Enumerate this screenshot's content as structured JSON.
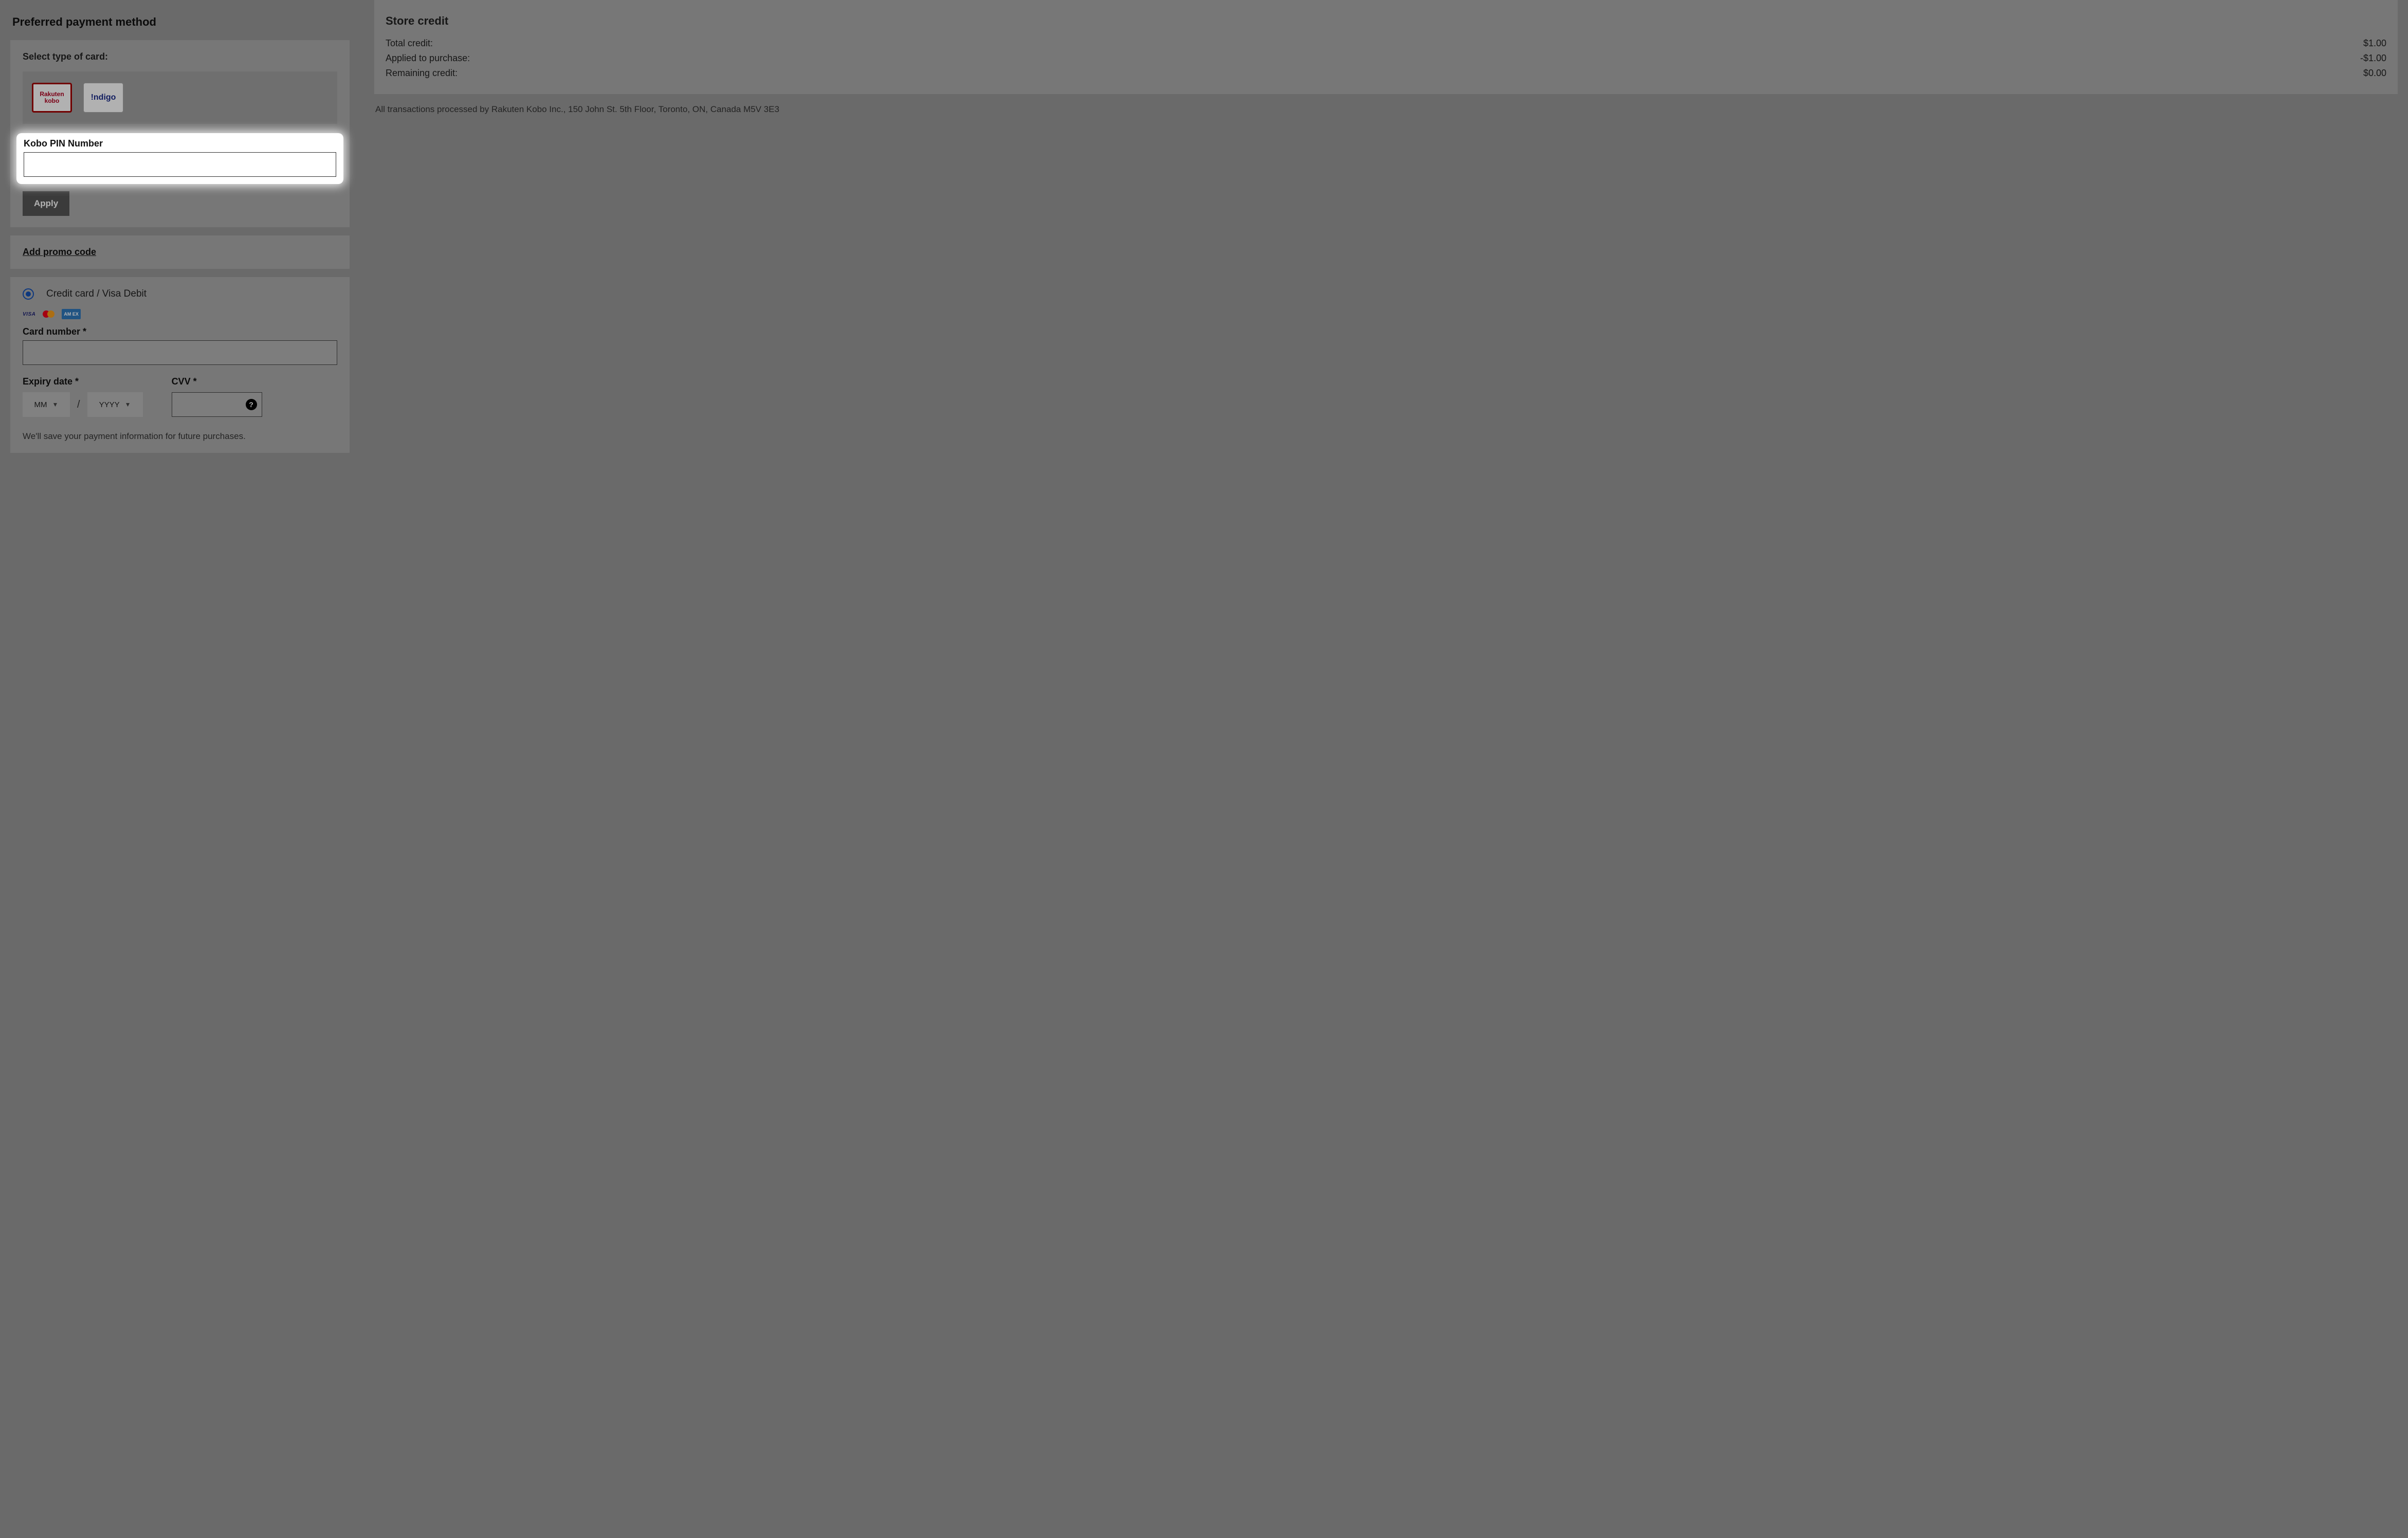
{
  "left": {
    "title": "Preferred payment method",
    "select_card_label": "Select type of card:",
    "card_tiles": {
      "kobo_line1": "Rakuten",
      "kobo_line2": "kobo",
      "indigo": "!ndigo"
    },
    "pin_label": "Kobo PIN Number",
    "apply_label": "Apply",
    "promo_link": "Add promo code",
    "cc_radio_label": "Credit card / Visa Debit",
    "logos": {
      "visa": "VISA",
      "amex": "AM\nEX"
    },
    "card_number_label": "Card number *",
    "expiry_label": "Expiry date *",
    "expiry_mm": "MM",
    "expiry_sep": "/",
    "expiry_yyyy": "YYYY",
    "cvv_label": "CVV *",
    "help_glyph": "?",
    "save_note": "We'll save your payment information for future purchases."
  },
  "right": {
    "title": "Store credit",
    "rows": [
      {
        "label": "Total credit:",
        "value": "$1.00"
      },
      {
        "label": "Applied to purchase:",
        "value": "-$1.00"
      },
      {
        "label": "Remaining credit:",
        "value": "$0.00"
      }
    ],
    "disclaimer": "All transactions processed by Rakuten Kobo Inc., 150 John St. 5th Floor, Toronto, ON, Canada M5V 3E3"
  }
}
